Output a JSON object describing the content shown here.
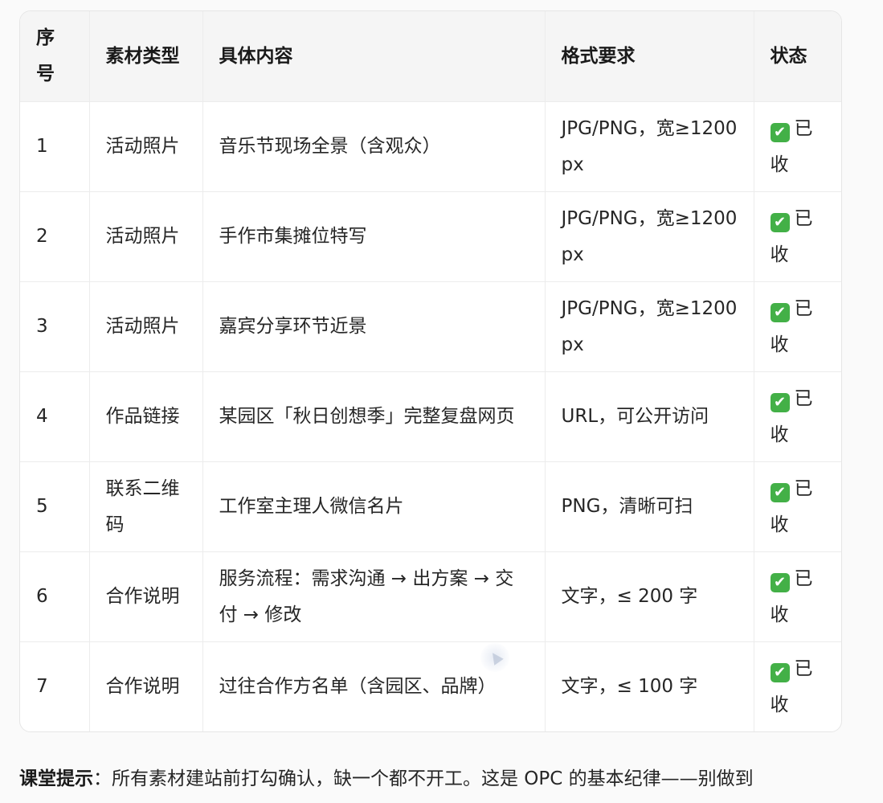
{
  "table": {
    "headers": [
      "序号",
      "素材类型",
      "具体内容",
      "格式要求",
      "状态"
    ],
    "rows": [
      {
        "no": "1",
        "type": "活动照片",
        "content": "音乐节现场全景（含观众）",
        "format": "JPG/PNG，宽≥1200px",
        "status": "已收"
      },
      {
        "no": "2",
        "type": "活动照片",
        "content": "手作市集摊位特写",
        "format": "JPG/PNG，宽≥1200px",
        "status": "已收"
      },
      {
        "no": "3",
        "type": "活动照片",
        "content": "嘉宾分享环节近景",
        "format": "JPG/PNG，宽≥1200px",
        "status": "已收"
      },
      {
        "no": "4",
        "type": "作品链接",
        "content": "某园区「秋日创想季」完整复盘网页",
        "format": "URL，可公开访问",
        "status": "已收"
      },
      {
        "no": "5",
        "type": "联系二维码",
        "content": "工作室主理人微信名片",
        "format": "PNG，清晰可扫",
        "status": "已收"
      },
      {
        "no": "6",
        "type": "合作说明",
        "content": "服务流程：需求沟通 → 出方案 → 交付 → 修改",
        "format": "文字，≤ 200 字",
        "status": "已收"
      },
      {
        "no": "7",
        "type": "合作说明",
        "content": "过往合作方名单（含园区、品牌）",
        "format": "文字，≤ 100 字",
        "status": "已收"
      }
    ],
    "status_icon": "check-mark-icon",
    "status_color": "#43b047"
  },
  "tip": {
    "label": "课堂提示",
    "text": "：所有素材建站前打勾确认，缺一个都不开工。这是 OPC 的基本纪律——别做到"
  }
}
